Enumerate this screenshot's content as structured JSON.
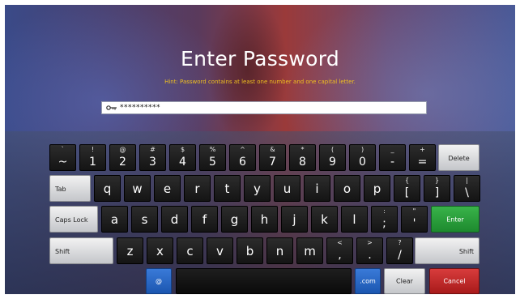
{
  "title": "Enter Password",
  "hint": "Hint: Password contains at least one number and one capital letter.",
  "password_field": {
    "masked_value": "**********",
    "icon": "key-icon"
  },
  "colors": {
    "hint": "#f0c020",
    "enter": "#2aa03c",
    "cancel": "#c82828",
    "blue_key": "#2a66c4"
  },
  "keyboard": {
    "row1": [
      {
        "main": "~",
        "shift": "`"
      },
      {
        "main": "1",
        "shift": "!"
      },
      {
        "main": "2",
        "shift": "@"
      },
      {
        "main": "3",
        "shift": "#"
      },
      {
        "main": "4",
        "shift": "$"
      },
      {
        "main": "5",
        "shift": "%"
      },
      {
        "main": "6",
        "shift": "^"
      },
      {
        "main": "7",
        "shift": "&"
      },
      {
        "main": "8",
        "shift": "*"
      },
      {
        "main": "9",
        "shift": "("
      },
      {
        "main": "0",
        "shift": ")"
      },
      {
        "main": "-",
        "shift": "_"
      },
      {
        "main": "=",
        "shift": "+"
      }
    ],
    "delete": "Delete",
    "tab": "Tab",
    "row2": [
      {
        "main": "q"
      },
      {
        "main": "w"
      },
      {
        "main": "e"
      },
      {
        "main": "r"
      },
      {
        "main": "t"
      },
      {
        "main": "y"
      },
      {
        "main": "u"
      },
      {
        "main": "i"
      },
      {
        "main": "o"
      },
      {
        "main": "p"
      },
      {
        "main": "[",
        "shift": "{"
      },
      {
        "main": "]",
        "shift": "}"
      },
      {
        "main": "\\",
        "shift": "|"
      }
    ],
    "caps_lock": "Caps Lock",
    "row3": [
      {
        "main": "a"
      },
      {
        "main": "s"
      },
      {
        "main": "d"
      },
      {
        "main": "f"
      },
      {
        "main": "g"
      },
      {
        "main": "h"
      },
      {
        "main": "j"
      },
      {
        "main": "k"
      },
      {
        "main": "l"
      },
      {
        "main": ";",
        "shift": ":"
      },
      {
        "main": "'",
        "shift": "\""
      }
    ],
    "enter": "Enter",
    "shift_left": "Shift",
    "row4": [
      {
        "main": "z"
      },
      {
        "main": "x"
      },
      {
        "main": "c"
      },
      {
        "main": "v"
      },
      {
        "main": "b"
      },
      {
        "main": "n"
      },
      {
        "main": "m"
      },
      {
        "main": ",",
        "shift": "<"
      },
      {
        "main": ".",
        "shift": ">"
      },
      {
        "main": "/",
        "shift": "?"
      }
    ],
    "shift_right": "Shift",
    "at": "@",
    "dotcom": ".com",
    "clear": "Clear",
    "cancel": "Cancel"
  }
}
